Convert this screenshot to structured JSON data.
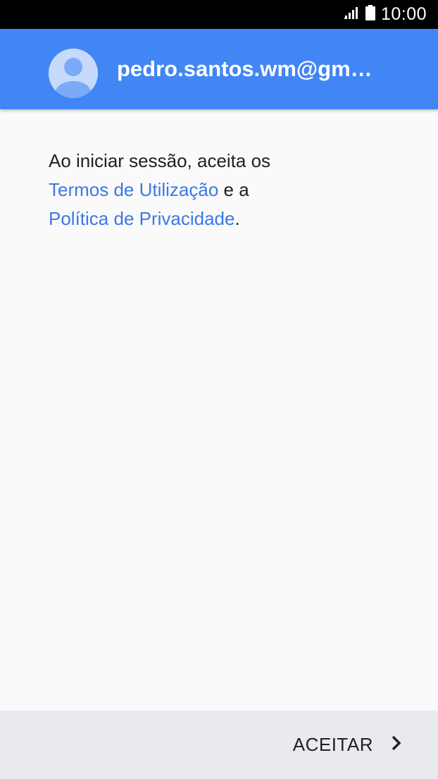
{
  "status_bar": {
    "time": "10:00",
    "signal_icon": "signal-icon",
    "battery_icon": "battery-icon"
  },
  "header": {
    "avatar_icon": "person-icon",
    "account_email": "pedro.santos.wm@gm…",
    "background_color": "#4285f4"
  },
  "content": {
    "text_before": "Ao iniciar sessão, aceita os",
    "terms_link": "Termos de Utilização",
    "connector": " e a",
    "privacy_link": "Política de Privacidade",
    "end_punctuation": ".",
    "link_color": "#3b78e7"
  },
  "footer": {
    "accept_label": "ACEITAR",
    "accept_icon": "chevron-right-icon"
  }
}
